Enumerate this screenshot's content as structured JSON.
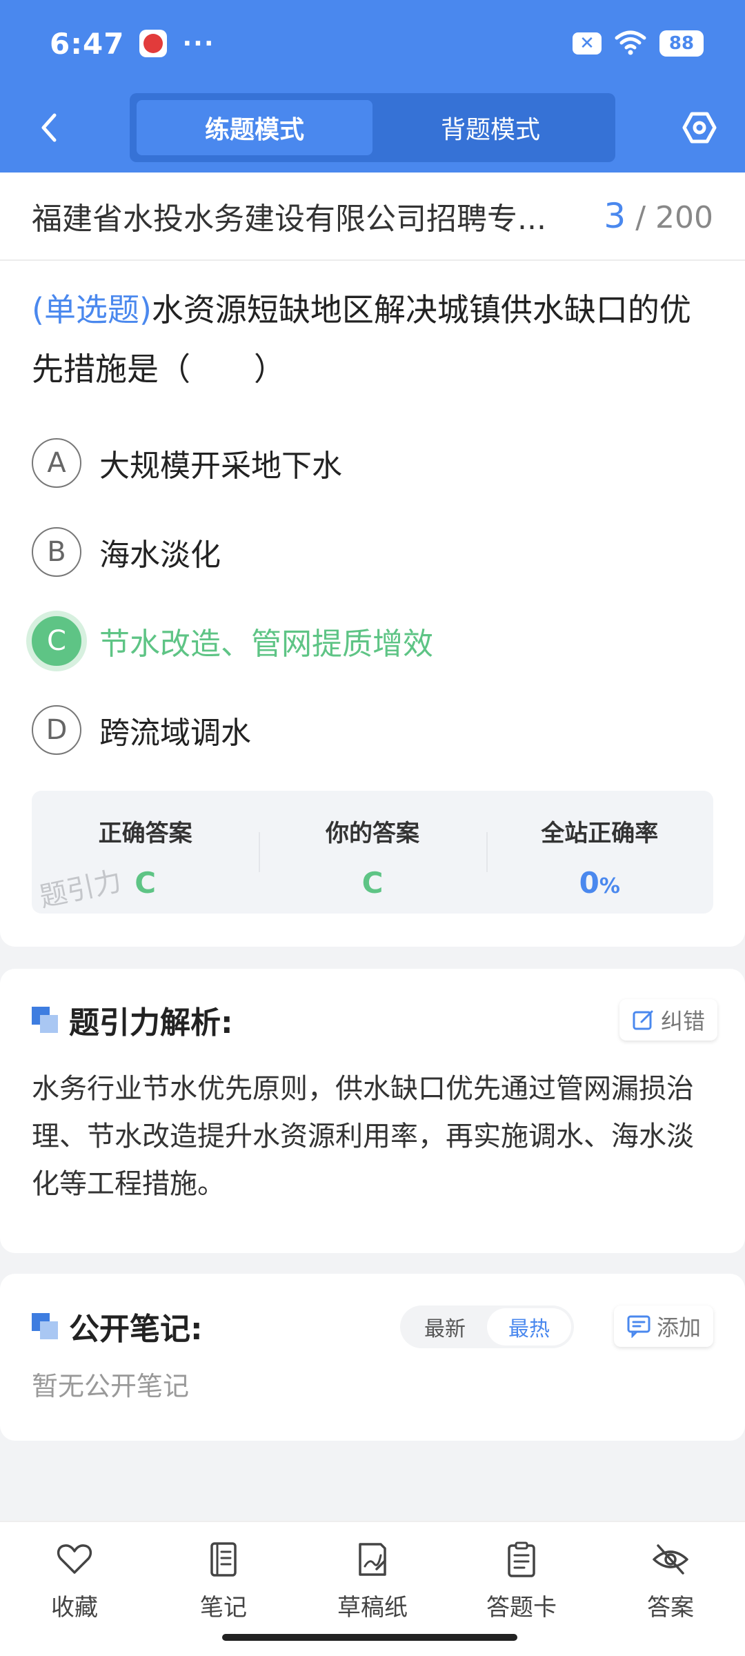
{
  "status_bar": {
    "time": "6:47",
    "more": "···",
    "sim_badge": "✕",
    "battery": "88"
  },
  "nav": {
    "modes": [
      {
        "label": "练题模式",
        "active": true
      },
      {
        "label": "背题模式",
        "active": false
      }
    ]
  },
  "header": {
    "exam_title": "福建省水投水务建设有限公司招聘专...",
    "progress_current": "3",
    "progress_total": "/ 200"
  },
  "question": {
    "type_label": "(单选题)",
    "text": "水资源短缺地区解决城镇供水缺口的优先措施是（　　）",
    "options": [
      {
        "letter": "A",
        "text": "大规模开采地下水",
        "state": "normal"
      },
      {
        "letter": "B",
        "text": "海水淡化",
        "state": "normal"
      },
      {
        "letter": "C",
        "text": "节水改造、管网提质增效",
        "state": "correct"
      },
      {
        "letter": "D",
        "text": "跨流域调水",
        "state": "normal"
      }
    ]
  },
  "answer_summary": {
    "correct_label": "正确答案",
    "correct_value": "C",
    "yours_label": "你的答案",
    "yours_value": "C",
    "rate_label": "全站正确率",
    "rate_value": "0",
    "rate_unit": "%",
    "watermark": "题引力"
  },
  "analysis": {
    "title": "题引力解析:",
    "report_label": "纠错",
    "text": "水务行业节水优先原则，供水缺口优先通过管网漏损治理、节水改造提升水资源利用率，再实施调水、海水淡化等工程措施。"
  },
  "notes": {
    "title": "公开笔记:",
    "sort_latest": "最新",
    "sort_hot": "最热",
    "add_label": "添加",
    "empty_text": "暂无公开笔记"
  },
  "bottom_bar": {
    "items": [
      {
        "label": "收藏",
        "icon": "heart-icon"
      },
      {
        "label": "笔记",
        "icon": "notebook-icon"
      },
      {
        "label": "草稿纸",
        "icon": "draft-paper-icon"
      },
      {
        "label": "答题卡",
        "icon": "answer-card-icon"
      },
      {
        "label": "答案",
        "icon": "eye-off-icon"
      }
    ]
  },
  "colors": {
    "brand_blue": "#4a88ee",
    "correct_green": "#5ec485"
  }
}
